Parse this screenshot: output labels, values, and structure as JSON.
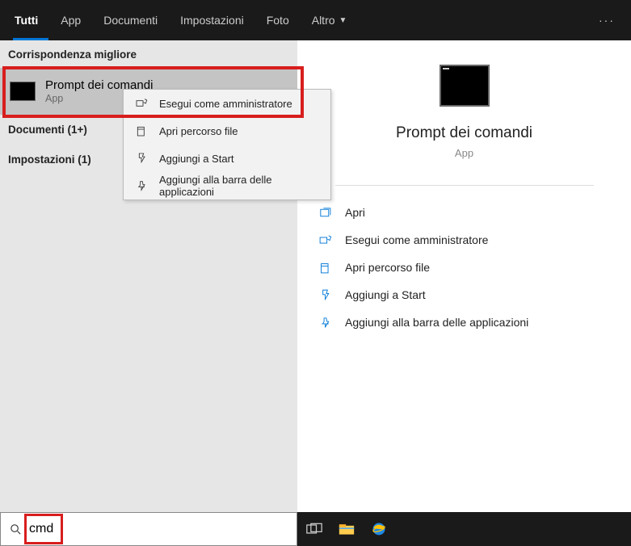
{
  "tabs": {
    "all": "Tutti",
    "apps": "App",
    "docs": "Documenti",
    "settings": "Impostazioni",
    "photos": "Foto",
    "more": "Altro"
  },
  "left": {
    "best_match_header": "Corrispondenza migliore",
    "best_match_title": "Prompt dei comandi",
    "best_match_sub": "App",
    "cat_documents": "Documenti (1+)",
    "cat_settings": "Impostazioni (1)"
  },
  "ctx": {
    "run_admin": "Esegui come amministratore",
    "open_loc": "Apri percorso file",
    "pin_start": "Aggiungi a Start",
    "pin_taskbar": "Aggiungi alla barra delle applicazioni"
  },
  "right": {
    "title": "Prompt dei comandi",
    "sub": "App",
    "open": "Apri",
    "run_admin": "Esegui come amministratore",
    "open_loc": "Apri percorso file",
    "pin_start": "Aggiungi a Start",
    "pin_taskbar": "Aggiungi alla barra delle applicazioni"
  },
  "search": {
    "value": "cmd"
  }
}
